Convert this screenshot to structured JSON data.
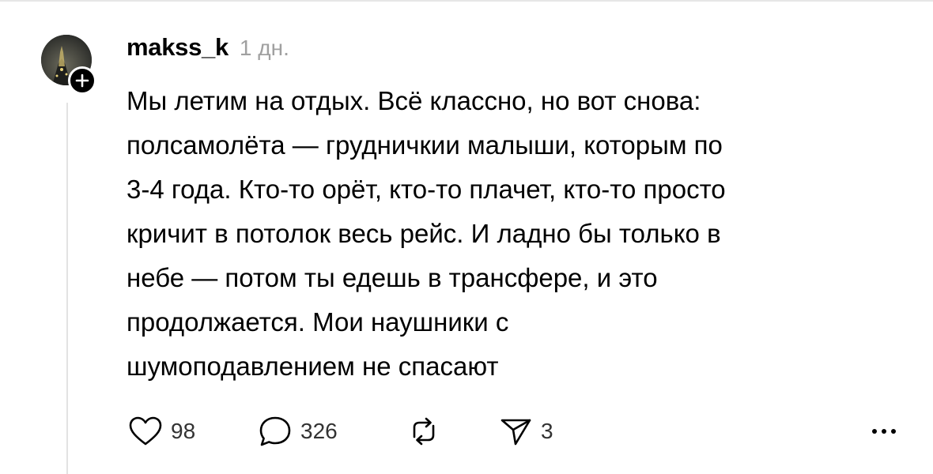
{
  "post": {
    "username": "makss_k",
    "timestamp": "1 дн.",
    "text_lines": [
      "Мы летим на отдых. Всё классно, но вот снова:",
      "полсамолёта — грудничкии малыши, которым по",
      "3-4 года. Кто-то орёт, кто-то плачет, кто-то просто",
      "кричит в потолок весь рейс. И ладно бы только в",
      "небе — потом ты едешь в трансфере, и это",
      "продолжается. Мои наушники с",
      "шумоподавлением не спасают"
    ]
  },
  "actions": {
    "likes": "98",
    "comments": "326",
    "shares": "3"
  },
  "icons": {
    "like": "heart-icon",
    "comment": "speech-bubble-icon",
    "repost": "repost-icon",
    "share": "paper-plane-icon",
    "more": "more-dots-icon",
    "follow": "plus-icon"
  },
  "colors": {
    "text": "#000000",
    "muted": "#a0a0a0",
    "thread_line": "#e3e3e3"
  }
}
